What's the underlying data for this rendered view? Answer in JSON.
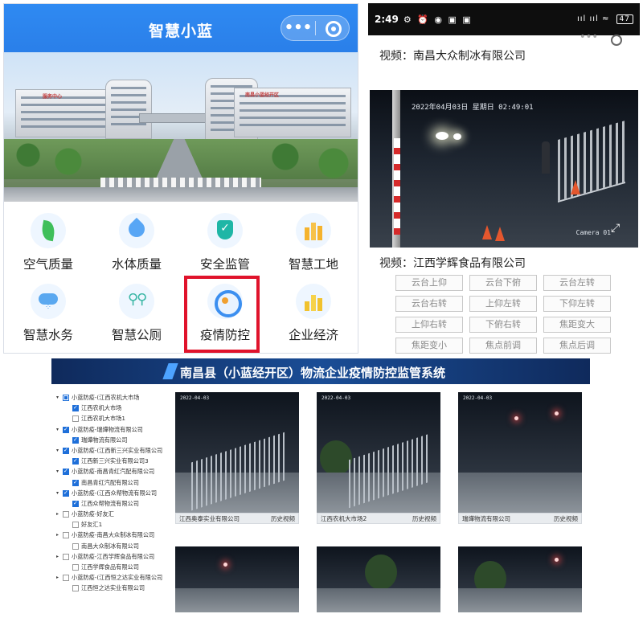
{
  "mini_program": {
    "title": "智慧小蓝",
    "capsule_more": "•••",
    "banner": {
      "sign_left": "服务中心",
      "sign_right": "南昌小蓝经开区"
    },
    "tiles": [
      {
        "label": "空气质量",
        "icon": "leaf-icon"
      },
      {
        "label": "水体质量",
        "icon": "water-drop-icon"
      },
      {
        "label": "安全监管",
        "icon": "shield-check-icon"
      },
      {
        "label": "智慧工地",
        "icon": "building-icon"
      },
      {
        "label": "智慧水务",
        "icon": "rain-cloud-icon"
      },
      {
        "label": "智慧公厕",
        "icon": "toilet-icon"
      },
      {
        "label": "疫情防控",
        "icon": "camera-icon"
      },
      {
        "label": "企业经济",
        "icon": "economy-icon"
      }
    ],
    "highlighted_tile": "疫情防控",
    "highlight_color": "#e0132b"
  },
  "phone": {
    "status": {
      "time": "2:49",
      "icons": "⚙ ⏰ ◉ ▣ ▣",
      "signal": "ııl ııl ≈",
      "battery": "47"
    },
    "video1_label": "视频：南昌大众制冰有限公司",
    "camera": {
      "osd": "2022年04月03日 星期日 02:49:01",
      "name": "Camera 01"
    },
    "video2_label": "视频：江西学辉食品有限公司",
    "ptz_buttons": [
      "云台上仰",
      "云台下俯",
      "云台左转",
      "云台右转",
      "上仰左转",
      "下仰左转",
      "上仰右转",
      "下俯右转",
      "焦距变大",
      "焦距变小",
      "焦点前调",
      "焦点后调"
    ]
  },
  "desktop": {
    "title": "南昌县（小蓝经开区）物流企业疫情防控监管系统",
    "header_color": "#1a4d96",
    "tree": [
      {
        "text": "小蓝防疫-(江西农机大市场",
        "level": 0,
        "state": "partial",
        "expand": "▾"
      },
      {
        "text": "江西农机大市场",
        "level": 1,
        "state": "checked"
      },
      {
        "text": "江西农机大市场1",
        "level": 1,
        "state": "unchecked"
      },
      {
        "text": "小蓝防疫-瑞燁物流有限公司",
        "level": 0,
        "state": "checked",
        "expand": "▾"
      },
      {
        "text": "瑞燁物流有限公司",
        "level": 1,
        "state": "checked"
      },
      {
        "text": "小蓝防疫-(江西新三兴实业有限公司",
        "level": 0,
        "state": "checked",
        "expand": "▾"
      },
      {
        "text": "江西新三兴实业有限公司3",
        "level": 1,
        "state": "checked"
      },
      {
        "text": "小蓝防疫-南昌青红汽配有限公司",
        "level": 0,
        "state": "checked",
        "expand": "▾"
      },
      {
        "text": "南昌青红汽配有限公司",
        "level": 1,
        "state": "checked"
      },
      {
        "text": "小蓝防疫-(江西众帮物流有限公司",
        "level": 0,
        "state": "checked",
        "expand": "▾"
      },
      {
        "text": "江西众帮物流有限公司",
        "level": 1,
        "state": "checked"
      },
      {
        "text": "小蓝防疫-好友汇",
        "level": 0,
        "state": "unchecked",
        "expand": "▸"
      },
      {
        "text": "好友汇1",
        "level": 1,
        "state": "unchecked"
      },
      {
        "text": "小蓝防疫-南昌大众制冰有限公司",
        "level": 0,
        "state": "unchecked",
        "expand": "▸"
      },
      {
        "text": "南昌大众制冰有限公司",
        "level": 1,
        "state": "unchecked"
      },
      {
        "text": "小蓝防疫-江西学辉食品有限公司",
        "level": 0,
        "state": "unchecked",
        "expand": "▸"
      },
      {
        "text": "江西学辉食品有限公司",
        "level": 1,
        "state": "unchecked"
      },
      {
        "text": "小蓝防疫-(江西恒之达实业有限公司",
        "level": 0,
        "state": "unchecked",
        "expand": "▸"
      },
      {
        "text": "江西恒之达实业有限公司",
        "level": 1,
        "state": "unchecked"
      }
    ],
    "videos": [
      {
        "caption": "江西奥泰实业有限公司",
        "history": "历史视频"
      },
      {
        "caption": "江西农机大市场2",
        "history": "历史视频"
      },
      {
        "caption": "瑞燁物流有限公司",
        "history": "历史视频"
      },
      {
        "caption": "",
        "history": ""
      },
      {
        "caption": "",
        "history": ""
      },
      {
        "caption": "",
        "history": ""
      }
    ]
  }
}
